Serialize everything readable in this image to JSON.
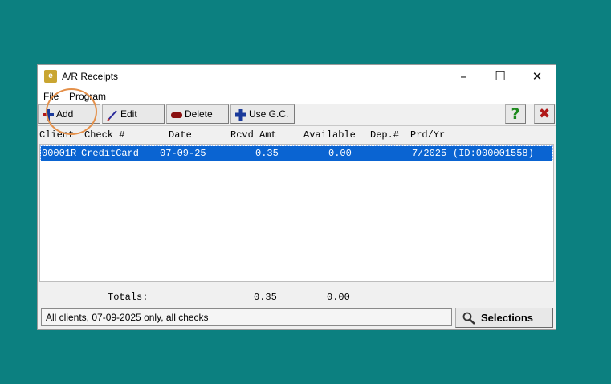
{
  "window": {
    "title": "A/R Receipts",
    "app_icon": "e",
    "controls": {
      "minimize": "–",
      "maximize": "☐",
      "close": "✕"
    }
  },
  "menu": {
    "file": "File",
    "program": "Program"
  },
  "toolbar": {
    "add_label": "Add",
    "edit_label": "Edit",
    "delete_label": "Delete",
    "usegc_label": "Use G.C.",
    "help_glyph": "?",
    "exit_glyph": "✖"
  },
  "columns": {
    "client": "Client",
    "check": "Check #",
    "date": "Date",
    "rcvd_amt": "Rcvd Amt",
    "available": "Available",
    "dep": "Dep.#",
    "prd_yr": "Prd/Yr"
  },
  "rows": [
    {
      "client": "00001R",
      "check": "CreditCard",
      "date": "07-09-25",
      "rcvd_amt": "0.35",
      "available": "0.00",
      "dep": "",
      "prd_yr": "7/2025",
      "id": "(ID:000001558)"
    }
  ],
  "totals": {
    "label": "Totals:",
    "rcvd_amt": "0.35",
    "available": "0.00"
  },
  "status_text": "All clients, 07-09-2025 only, all checks",
  "selections_label": "Selections",
  "colors": {
    "desktop": "#0c8080",
    "selection": "#0a64d2",
    "highlight": "#e4904a"
  }
}
